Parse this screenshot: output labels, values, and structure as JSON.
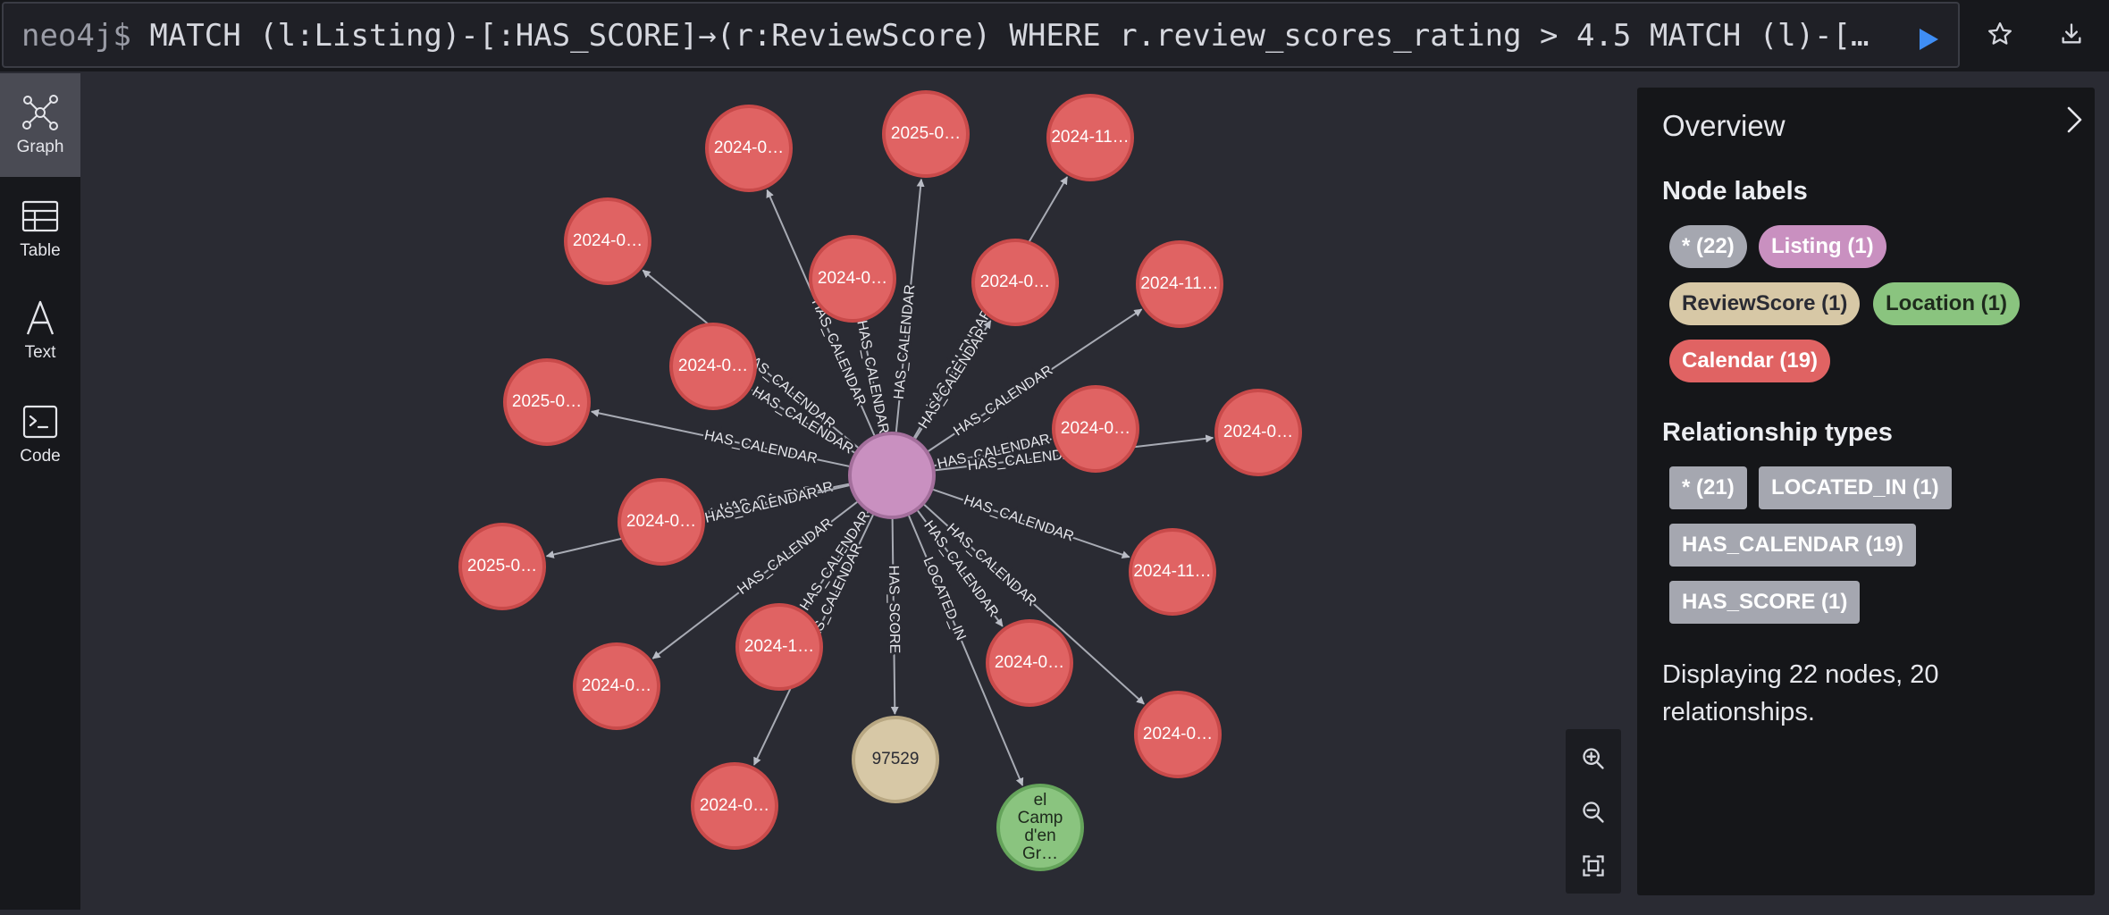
{
  "query": {
    "prompt": "neo4j$",
    "text": "MATCH (l:Listing)-[:HAS_SCORE]→(r:ReviewScore) WHERE r.review_scores_rating > 4.5 MATCH (l)-[…",
    "run_icon": "play-icon",
    "favorite_icon": "star-icon",
    "download_icon": "download-icon"
  },
  "sidebar": {
    "items": [
      {
        "label": "Graph",
        "icon": "graph-icon",
        "active": true
      },
      {
        "label": "Table",
        "icon": "table-icon",
        "active": false
      },
      {
        "label": "Text",
        "icon": "text-icon",
        "active": false
      },
      {
        "label": "Code",
        "icon": "code-icon",
        "active": false
      }
    ]
  },
  "graph": {
    "center_color": "#c990c0",
    "calendar_color": "#e06363",
    "reviewscore_color": "#d7c8a6",
    "location_color": "#8ac47f",
    "nodes": [
      {
        "label": "2024-0…",
        "type": "Calendar"
      },
      {
        "label": "2025-0…",
        "type": "Calendar"
      },
      {
        "label": "2024-11…",
        "type": "Calendar"
      },
      {
        "label": "2024-0…",
        "type": "Calendar"
      },
      {
        "label": "2024-0…",
        "type": "Calendar"
      },
      {
        "label": "2024-0…",
        "type": "Calendar"
      },
      {
        "label": "2024-11…",
        "type": "Calendar"
      },
      {
        "label": "2024-0…",
        "type": "Calendar"
      },
      {
        "label": "2025-0…",
        "type": "Calendar"
      },
      {
        "label": "2024-0…",
        "type": "Calendar"
      },
      {
        "label": "2024-0…",
        "type": "Calendar"
      },
      {
        "label": "2024-0…",
        "type": "Calendar"
      },
      {
        "label": "2025-0…",
        "type": "Calendar"
      },
      {
        "label": "2024-11…",
        "type": "Calendar"
      },
      {
        "label": "2024-1…",
        "type": "Calendar"
      },
      {
        "label": "2024-0…",
        "type": "Calendar"
      },
      {
        "label": "2024-0…",
        "type": "Calendar"
      },
      {
        "label": "2024-0…",
        "type": "Calendar"
      },
      {
        "label": "2024-0…",
        "type": "Calendar"
      },
      {
        "label": "97529",
        "type": "ReviewScore"
      },
      {
        "label": "el Camp d'en Gr…",
        "lines": [
          "el",
          "Camp",
          "d'en",
          "Gr…"
        ],
        "type": "Location"
      }
    ],
    "edge_labels": {
      "calendar": "HAS_CALENDAR",
      "calendar_short": "HAS_CALEN…",
      "calendar_fragment": "HAS_C",
      "calendar_tail": "ENDAR",
      "score": "HAS_SCORE",
      "located": "LOCATED_IN"
    }
  },
  "zoom": {
    "zoom_in_icon": "zoom-in-icon",
    "zoom_out_icon": "zoom-out-icon",
    "fit_icon": "fit-screen-icon"
  },
  "overview": {
    "title": "Overview",
    "node_labels_title": "Node labels",
    "node_labels": [
      {
        "label": "* (22)",
        "bg": "#a5a7b0",
        "fg": "#ffffff"
      },
      {
        "label": "Listing (1)",
        "bg": "#c990c0",
        "fg": "#ffffff"
      },
      {
        "label": "ReviewScore (1)",
        "bg": "#d7c8a6",
        "fg": "#2a2b33"
      },
      {
        "label": "Location (1)",
        "bg": "#8ac47f",
        "fg": "#1e2a1c"
      },
      {
        "label": "Calendar (19)",
        "bg": "#e06363",
        "fg": "#ffffff"
      }
    ],
    "rel_types_title": "Relationship types",
    "rel_types": [
      {
        "label": "* (21)"
      },
      {
        "label": "LOCATED_IN (1)"
      },
      {
        "label": "HAS_CALENDAR (19)"
      },
      {
        "label": "HAS_SCORE (1)"
      }
    ],
    "summary": "Displaying 22 nodes, 20 relationships."
  }
}
